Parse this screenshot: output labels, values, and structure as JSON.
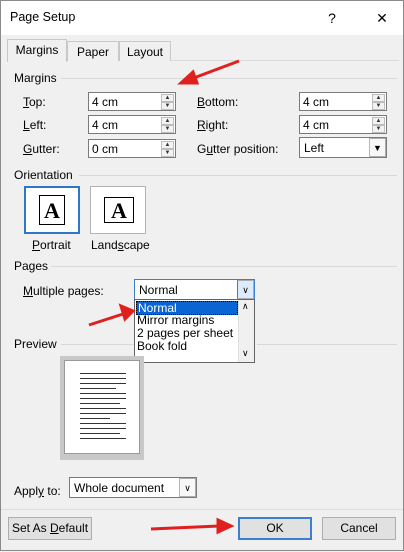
{
  "window": {
    "title": "Page Setup",
    "help_glyph": "?",
    "close_glyph": "✕"
  },
  "tabs": [
    {
      "label": "Margins",
      "active": true
    },
    {
      "label": "Paper",
      "active": false
    },
    {
      "label": "Layout",
      "active": false
    }
  ],
  "margins": {
    "section_label": "Margins",
    "top": {
      "label_u": "T",
      "label_rest": "op:",
      "value": "4 cm"
    },
    "bottom": {
      "label_u": "B",
      "label_rest": "ottom:",
      "value": "4 cm"
    },
    "left": {
      "label_u": "L",
      "label_rest": "eft:",
      "value": "4 cm"
    },
    "right": {
      "label_u": "R",
      "label_rest": "ight:",
      "value": "4 cm"
    },
    "gutter": {
      "label_u": "G",
      "label_rest": "utter:",
      "value": "0 cm"
    },
    "gutter_position": {
      "label_pre": "G",
      "label_u": "u",
      "label_rest": "tter position:",
      "value": "Left"
    }
  },
  "orientation": {
    "section_label": "Orientation",
    "portrait": {
      "label_u": "P",
      "label_rest": "ortrait",
      "icon_letter": "A",
      "selected": true
    },
    "landscape": {
      "label_pre": "Land",
      "label_u": "s",
      "label_rest": "cape",
      "icon_letter": "A",
      "selected": false
    }
  },
  "pages": {
    "section_label": "Pages",
    "multiple_pages_label_u": "M",
    "multiple_pages_label_rest": "ultiple pages:",
    "multiple_pages_value": "Normal",
    "options": [
      "Normal",
      "Mirror margins",
      "2 pages per sheet",
      "Book fold"
    ],
    "selected_index": 0
  },
  "preview": {
    "section_label": "Preview"
  },
  "apply_to": {
    "label_pre": "Appl",
    "label_u": "y",
    "label_rest": " to:",
    "value": "Whole document"
  },
  "buttons": {
    "set_default_pre": "Set As ",
    "set_default_u": "D",
    "set_default_rest": "efault",
    "ok": "OK",
    "cancel": "Cancel"
  },
  "annotation_color": "#e0201f"
}
